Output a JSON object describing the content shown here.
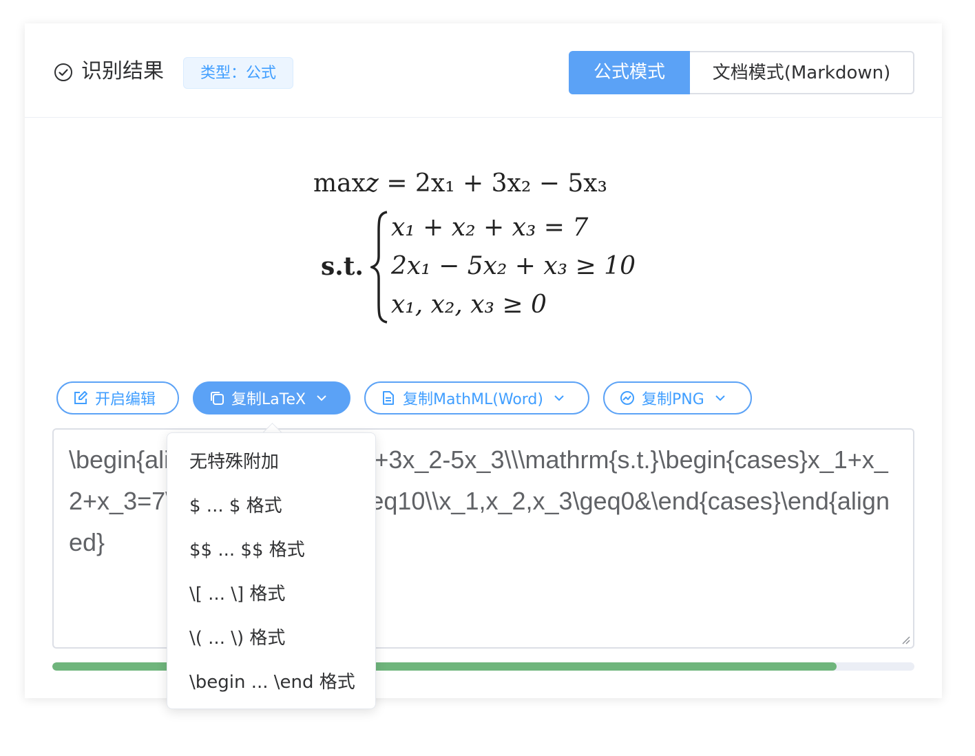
{
  "header": {
    "title": "识别结果",
    "type_tag": "类型：公式",
    "modes": [
      "公式模式",
      "文档模式(Markdown)"
    ]
  },
  "formula": {
    "line1": {
      "op": "max",
      "var": "z",
      "rhs": "= 2x₁ + 3x₂ − 5x₃"
    },
    "st_label": "s.t.",
    "cases": [
      "x₁ + x₂ + x₃ = 7",
      "2x₁ − 5x₂ + x₃ ≥ 10",
      "x₁, x₂, x₃ ≥ 0"
    ]
  },
  "actions": {
    "edit": "开启编辑",
    "copy_latex": "复制LaTeX",
    "copy_mathml": "复制MathML(Word)",
    "copy_png": "复制PNG"
  },
  "latex_text": "\\begin{aligned}\\max z=2x_1+3x_2-5x_3\\\\\\mathrm{s.t.}\\begin{cases}x_1+x_2+x_3=7\\\\2x_1-5x_2+x_3\\geq10\\\\x_1,x_2,x_3\\geq0&\\end{cases}\\end{aligned}",
  "progress": {
    "fraction": 0.91
  },
  "dropdown": {
    "items": [
      "无特殊附加",
      "$ ... $ 格式",
      "$$ ... $$ 格式",
      "\\[ ... \\] 格式",
      "\\( ... \\) 格式",
      "\\begin ... \\end 格式"
    ]
  },
  "colors": {
    "accent": "#5ba2f6",
    "progress": "#6fb57c"
  },
  "icons": [
    "check-circle-icon",
    "edit-icon",
    "copy-icon",
    "document-icon",
    "image-icon",
    "chevron-down-icon",
    "resize-handle-icon"
  ]
}
